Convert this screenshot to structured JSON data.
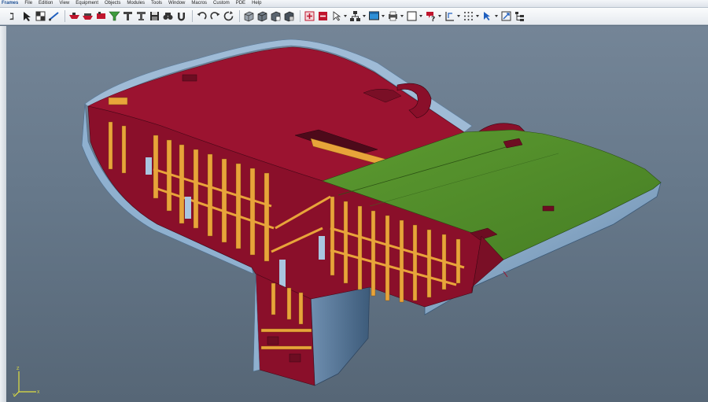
{
  "menu": {
    "items": [
      "Frames",
      "File",
      "Edition",
      "View",
      "Equipment",
      "Objects",
      "Modules",
      "Tools",
      "Window",
      "Macros",
      "Custom",
      "PDE",
      "Help"
    ]
  },
  "toolbar": {
    "tools": [
      "tool-a-icon",
      "cursor-icon",
      "checkerboard-icon",
      "line-icon",
      "hull-red-icon",
      "hull-red-2-icon",
      "shape-red-icon",
      "funnel-icon",
      "frame-t-icon",
      "frame-t-2-icon",
      "save-icon",
      "binoculars-icon",
      "magnet-icon",
      "undo-icon",
      "redo-icon",
      "refresh-icon",
      "box-3d-icon",
      "box-3d-2-icon",
      "box-3d-3-icon",
      "box-3d-4-icon",
      "section-red-icon",
      "section-red-2-icon",
      "pointer-arrow-icon",
      "network-icon",
      "screen-icon",
      "printer-icon",
      "window-icon",
      "question-icon",
      "dimension-icon",
      "grid-dots-icon",
      "select-arrow-icon",
      "scale-icon",
      "tree-icon"
    ]
  },
  "colors": {
    "deck_red": "#9b1330",
    "hull_red": "#8a0f2a",
    "deck_green": "#4f8a2a",
    "frame_orange": "#e8a43a",
    "hull_blue": "#7fa1c3",
    "viewport_bg": "#6a7b8d"
  },
  "viewport": {
    "axis": {
      "x_label": "X",
      "y_label": "Y",
      "z_label": "Z"
    }
  }
}
